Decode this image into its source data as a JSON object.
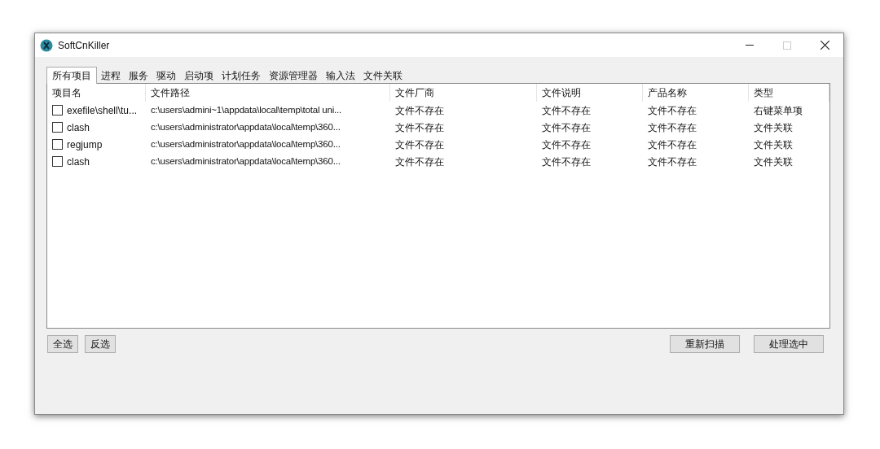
{
  "window": {
    "title": "SoftCnKiller"
  },
  "tabs": [
    {
      "label": "所有项目",
      "selected": true
    },
    {
      "label": "进程",
      "selected": false
    },
    {
      "label": "服务",
      "selected": false
    },
    {
      "label": "驱动",
      "selected": false
    },
    {
      "label": "启动项",
      "selected": false
    },
    {
      "label": "计划任务",
      "selected": false
    },
    {
      "label": "资源管理器",
      "selected": false
    },
    {
      "label": "输入法",
      "selected": false
    },
    {
      "label": "文件关联",
      "selected": false
    }
  ],
  "table": {
    "columns": [
      "项目名",
      "文件路径",
      "文件厂商",
      "文件说明",
      "产品名称",
      "类型"
    ],
    "rows": [
      {
        "checked": false,
        "cells": [
          "exefile\\shell\\tu...",
          "c:\\users\\admini~1\\appdata\\local\\temp\\total uni...",
          "文件不存在",
          "文件不存在",
          "文件不存在",
          "右键菜单项"
        ]
      },
      {
        "checked": false,
        "cells": [
          "clash",
          "c:\\users\\administrator\\appdata\\local\\temp\\360...",
          "文件不存在",
          "文件不存在",
          "文件不存在",
          "文件关联"
        ]
      },
      {
        "checked": false,
        "cells": [
          "regjump",
          "c:\\users\\administrator\\appdata\\local\\temp\\360...",
          "文件不存在",
          "文件不存在",
          "文件不存在",
          "文件关联"
        ]
      },
      {
        "checked": false,
        "cells": [
          "clash",
          "c:\\users\\administrator\\appdata\\local\\temp\\360...",
          "文件不存在",
          "文件不存在",
          "文件不存在",
          "文件关联"
        ]
      }
    ]
  },
  "left_buttons": [
    "全选",
    "反选"
  ],
  "right_buttons": [
    "重新扫描",
    "处理选中"
  ]
}
